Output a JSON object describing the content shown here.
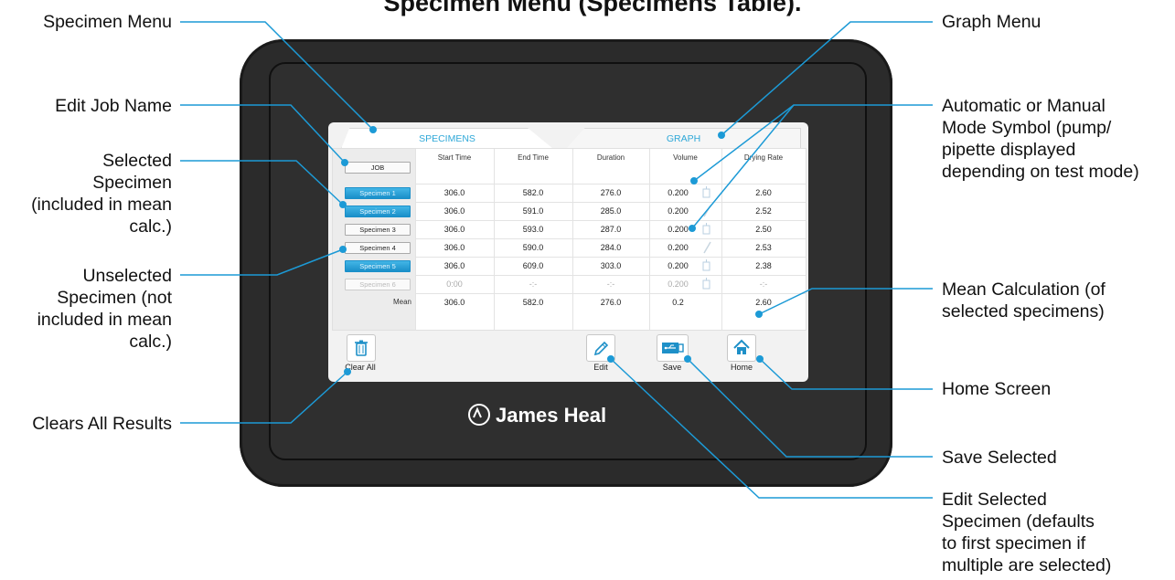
{
  "title": "Specimen Menu (Specimens Table).",
  "annotations_left": [
    {
      "lines": [
        "Specimen Menu"
      ]
    },
    {
      "lines": [
        "Edit Job Name"
      ]
    },
    {
      "lines": [
        "Selected",
        "Specimen",
        "(included in mean",
        "calc.)"
      ]
    },
    {
      "lines": [
        "Unselected",
        "Specimen (not",
        "included in mean",
        "calc.)"
      ]
    },
    {
      "lines": [
        "Clears All Results"
      ]
    }
  ],
  "annotations_right": [
    {
      "lines": [
        "Graph Menu"
      ]
    },
    {
      "lines": [
        "Automatic or Manual",
        "Mode Symbol (pump/",
        "pipette displayed",
        "depending on test mode)"
      ]
    },
    {
      "lines": [
        "Mean Calculation (of",
        "selected specimens)"
      ]
    },
    {
      "lines": [
        "Home Screen"
      ]
    },
    {
      "lines": [
        "Save Selected"
      ]
    },
    {
      "lines": [
        "Edit Selected",
        "Specimen (defaults",
        "to first specimen if",
        "multiple are selected)"
      ]
    }
  ],
  "tabs": {
    "specimens": "SPECIMENS",
    "graph": "GRAPH"
  },
  "job_button": "JOB",
  "columns": [
    "Start Time",
    "End Time",
    "Duration",
    "Volume",
    "Drying Rate"
  ],
  "rows": [
    {
      "name": "Specimen 1",
      "state": "selected",
      "start": "306.0",
      "end": "582.0",
      "duration": "276.0",
      "volume": "0.200",
      "mode": "pump",
      "rate": "2.60"
    },
    {
      "name": "Specimen 2",
      "state": "selected",
      "start": "306.0",
      "end": "591.0",
      "duration": "285.0",
      "volume": "0.200",
      "mode": "pipette",
      "rate": "2.52"
    },
    {
      "name": "Specimen 3",
      "state": "unselected",
      "start": "306.0",
      "end": "593.0",
      "duration": "287.0",
      "volume": "0.200",
      "mode": "pump",
      "rate": "2.50"
    },
    {
      "name": "Specimen 4",
      "state": "unselected",
      "start": "306.0",
      "end": "590.0",
      "duration": "284.0",
      "volume": "0.200",
      "mode": "pipette",
      "rate": "2.53"
    },
    {
      "name": "Specimen 5",
      "state": "selected",
      "start": "306.0",
      "end": "609.0",
      "duration": "303.0",
      "volume": "0.200",
      "mode": "pump",
      "rate": "2.38"
    },
    {
      "name": "Specimen 6",
      "state": "disabled",
      "start": "0:00",
      "end": "-:-",
      "duration": "-:-",
      "volume": "0.200",
      "mode": "pump",
      "rate": "-:-"
    }
  ],
  "mean": {
    "label": "Mean",
    "start": "306.0",
    "end": "582.0",
    "duration": "276.0",
    "volume": "0.2",
    "rate": "2.60"
  },
  "buttons": {
    "clear_all": "Clear All",
    "edit": "Edit",
    "save": "Save",
    "home": "Home"
  },
  "brand": "James Heal"
}
